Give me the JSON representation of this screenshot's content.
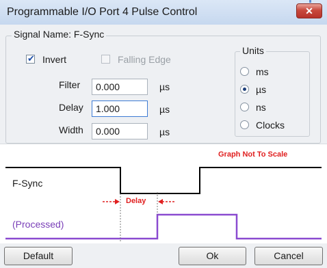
{
  "window": {
    "title": "Programmable I/O Port 4 Pulse Control",
    "close_glyph": "✕"
  },
  "signal": {
    "group_label": "Signal Name: F-Sync",
    "invert": {
      "label": "Invert",
      "checked": true
    },
    "falling_edge": {
      "label": "Falling Edge",
      "checked": false,
      "enabled": false
    }
  },
  "fields": [
    {
      "label": "Filter",
      "value": "0.000",
      "unit": "µs"
    },
    {
      "label": "Delay",
      "value": "1.000",
      "unit": "µs"
    },
    {
      "label": "Width",
      "value": "0.000",
      "unit": "µs"
    }
  ],
  "units": {
    "group_label": "Units",
    "options": [
      {
        "label": "ms",
        "selected": false
      },
      {
        "label": "µs",
        "selected": true
      },
      {
        "label": "ns",
        "selected": false
      },
      {
        "label": "Clocks",
        "selected": false
      }
    ]
  },
  "graph": {
    "note": "Graph Not To Scale",
    "signal_label": "F-Sync",
    "processed_label": "(Processed)",
    "delay_label": "Delay",
    "colors": {
      "signal": "#000000",
      "processed": "#8a4ad0",
      "annotation": "#e02020",
      "processed_text": "#7a3fb8"
    }
  },
  "buttons": {
    "default": "Default",
    "ok": "Ok",
    "cancel": "Cancel"
  }
}
